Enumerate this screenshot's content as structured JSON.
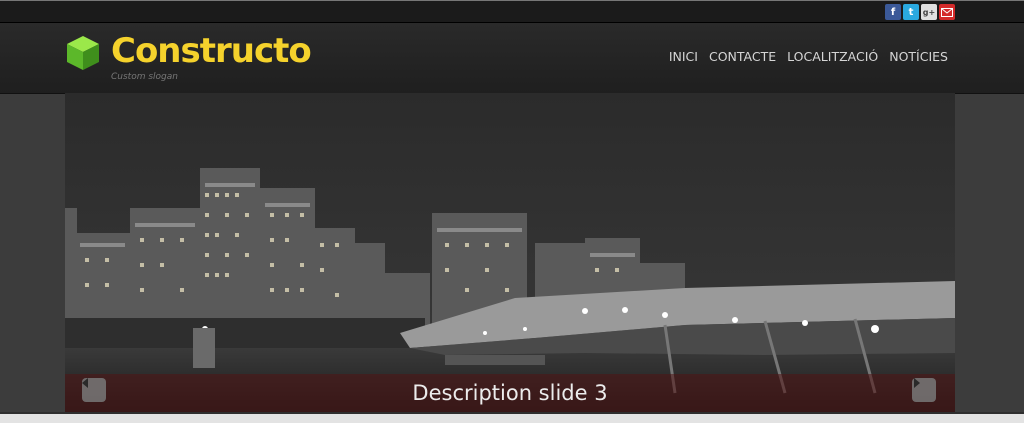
{
  "social": {
    "facebook": "f",
    "twitter": "t",
    "googleplus": "g+",
    "mail_icon": "envelope-icon"
  },
  "brand": {
    "name": "Constructo",
    "slogan": "Custom slogan",
    "logo_icon": "green-cube-icon",
    "color": "#f5d22c"
  },
  "nav": {
    "items": [
      "INICI",
      "CONTACTE",
      "LOCALITZACIÓ",
      "NOTÍCIES"
    ]
  },
  "slider": {
    "caption": "Description slide 3",
    "prev_icon": "chevron-left-icon",
    "next_icon": "chevron-right-icon"
  }
}
